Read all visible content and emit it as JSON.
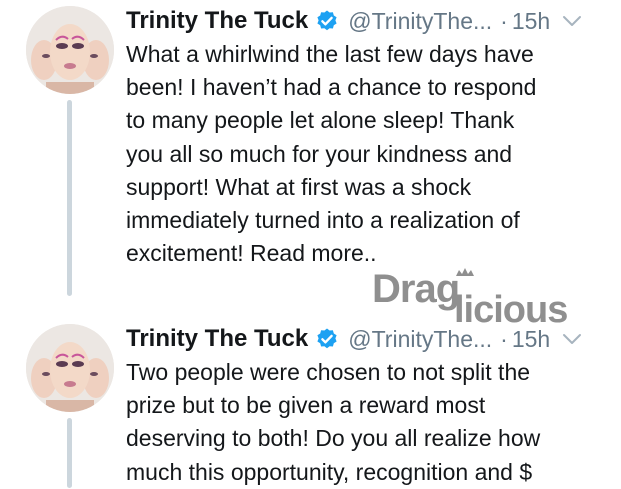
{
  "tweets": [
    {
      "author": "Trinity The Tuck",
      "handle": "@TrinityThe...",
      "separator": "·",
      "time": "15h",
      "lines": [
        "What a whirlwind the last few days have",
        "been! I haven’t had a chance to respond",
        "to many people let alone sleep! Thank",
        "you all so much for your kindness and",
        "support! What at first was a shock",
        "immediately turned into a realization of",
        "excitement! Read more.."
      ]
    },
    {
      "author": "Trinity The Tuck",
      "handle": "@TrinityThe...",
      "separator": "·",
      "time": "15h",
      "lines": [
        "Two people were chosen to not split the",
        "prize but to be given a reward most",
        "deserving to both! Do you all realize how",
        "much this opportunity, recognition and $"
      ]
    }
  ],
  "watermark": {
    "text": "Draglicious"
  },
  "icons": {
    "verified": "verified-badge-icon",
    "more": "chevron-down-icon"
  },
  "colors": {
    "text": "#14171a",
    "secondary": "#657786",
    "verified": "#1da1f2",
    "thread_line": "#ccd6dd",
    "watermark": "#8f8f8f"
  }
}
